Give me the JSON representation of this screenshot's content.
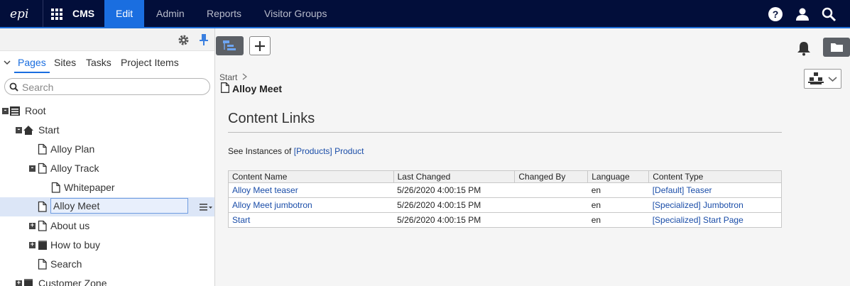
{
  "topbar": {
    "logo_text": "epi",
    "app_name": "CMS",
    "nav": [
      {
        "label": "Edit",
        "active": true
      },
      {
        "label": "Admin",
        "active": false
      },
      {
        "label": "Reports",
        "active": false
      },
      {
        "label": "Visitor Groups",
        "active": false
      }
    ],
    "icons": [
      "help-icon",
      "user-icon",
      "search-icon"
    ]
  },
  "navigation_pane": {
    "tabs": [
      "Pages",
      "Sites",
      "Tasks",
      "Project Items"
    ],
    "active_tab": "Pages",
    "search_placeholder": "Search",
    "search_value": "",
    "tree": [
      {
        "label": "Root",
        "level": 0,
        "expander": "minus",
        "icon": "root-list-icon"
      },
      {
        "label": "Start",
        "level": 1,
        "expander": "minus",
        "icon": "home-icon"
      },
      {
        "label": "Alloy Plan",
        "level": 2,
        "expander": "",
        "icon": "page-icon"
      },
      {
        "label": "Alloy Track",
        "level": 2,
        "expander": "minus",
        "icon": "page-icon"
      },
      {
        "label": "Whitepaper",
        "level": 3,
        "expander": "",
        "icon": "page-icon"
      },
      {
        "label": "Alloy Meet",
        "level": 2,
        "expander": "",
        "icon": "page-icon",
        "selected": true
      },
      {
        "label": "About us",
        "level": 2,
        "expander": "plus",
        "icon": "page-icon"
      },
      {
        "label": "How to buy",
        "level": 2,
        "expander": "plus",
        "icon": "container-icon"
      },
      {
        "label": "Search",
        "level": 2,
        "expander": "",
        "icon": "page-icon"
      },
      {
        "label": "Customer Zone",
        "level": 1,
        "expander": "plus",
        "icon": "container-icon"
      }
    ]
  },
  "main": {
    "breadcrumb": "Start",
    "page_name": "Alloy Meet",
    "section_title": "Content Links",
    "instances_prefix": "See Instances of",
    "instances_link": "[Products] Product",
    "table": {
      "headers": [
        "Content Name",
        "Last Changed",
        "Changed By",
        "Language",
        "Content Type"
      ],
      "rows": [
        {
          "name": "Alloy Meet teaser",
          "changed": "5/26/2020 4:00:15 PM",
          "by": "",
          "lang": "en",
          "type": "[Default] Teaser"
        },
        {
          "name": "Alloy Meet jumbotron",
          "changed": "5/26/2020 4:00:15 PM",
          "by": "",
          "lang": "en",
          "type": "[Specialized] Jumbotron"
        },
        {
          "name": "Start",
          "changed": "5/26/2020 4:00:15 PM",
          "by": "",
          "lang": "en",
          "type": "[Specialized] Start Page"
        }
      ]
    }
  },
  "colors": {
    "topbar_bg": "#020e3a",
    "active_tab": "#1a6ee0",
    "link": "#1a4da8",
    "selected_row": "#dce6f7"
  }
}
